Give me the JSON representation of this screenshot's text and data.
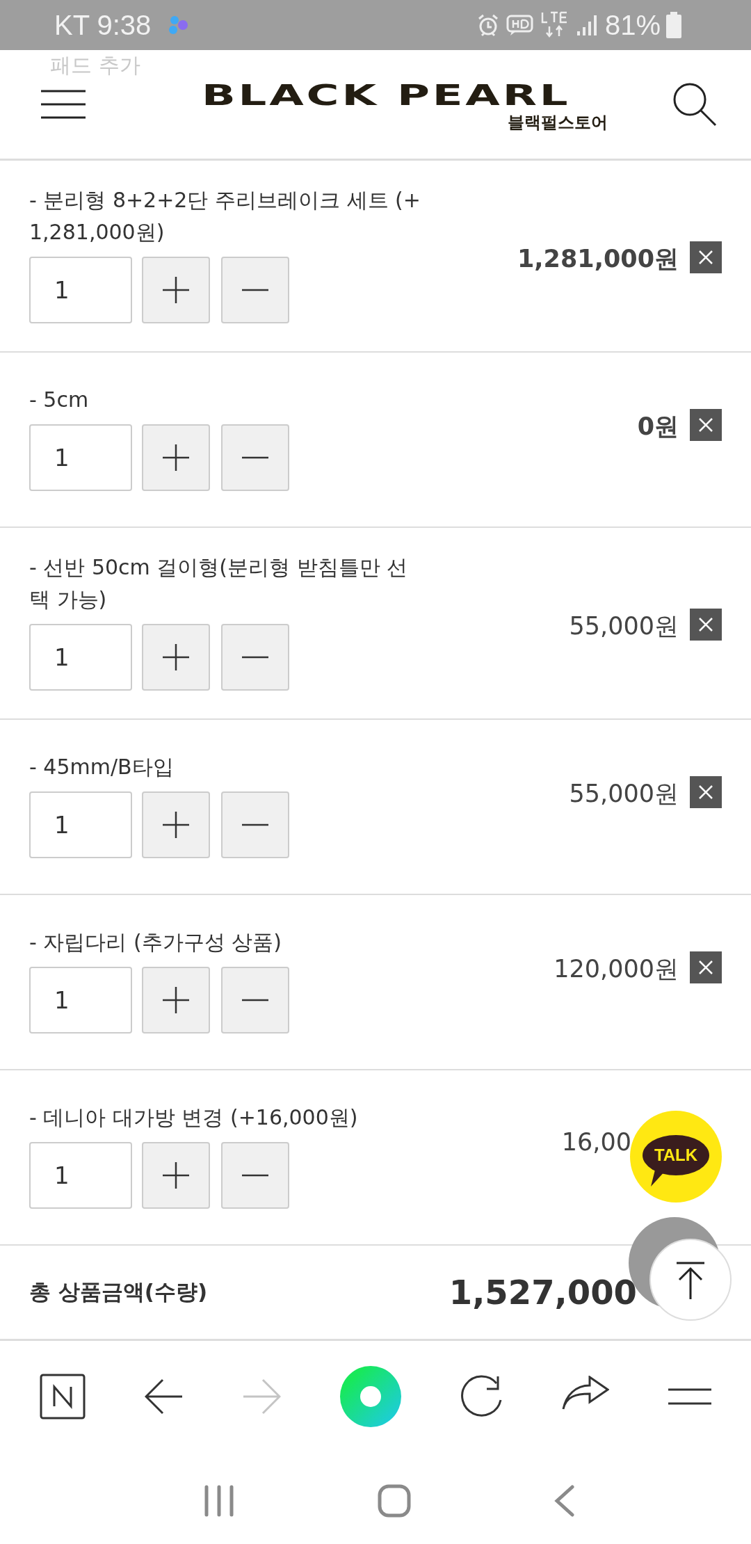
{
  "status_bar": {
    "carrier": "KT",
    "time": "9:38",
    "battery": "81%"
  },
  "ghost_text": "패드 추가",
  "header": {
    "logo": "BLACK PEARL",
    "logo_sub": "블랙펄스토어"
  },
  "items": [
    {
      "name": "- 분리형 8+2+2단 주리브레이크 세트 (+ 1,281,000원)",
      "quantity": "1",
      "price": "1,281,000원",
      "emphasized": true
    },
    {
      "name": "- 5cm",
      "quantity": "1",
      "price": "0원",
      "emphasized": true
    },
    {
      "name": "- 선반 50cm 걸이형(분리형 받침틀만 선택 가능)",
      "quantity": "1",
      "price": "55,000원",
      "emphasized": false
    },
    {
      "name": "- 45mm/B타입",
      "quantity": "1",
      "price": "55,000원",
      "emphasized": false
    },
    {
      "name": "- 자립다리 (추가구성 상품)",
      "quantity": "1",
      "price": "120,000원",
      "emphasized": false
    },
    {
      "name": "- 데니아 대가방 변경 (+16,000원)",
      "quantity": "1",
      "price": "16,00",
      "emphasized": false,
      "overlapped": true
    }
  ],
  "total": {
    "label": "총 상품금액(수량)",
    "amount": "1,527,000"
  },
  "talk_button": "TALK"
}
